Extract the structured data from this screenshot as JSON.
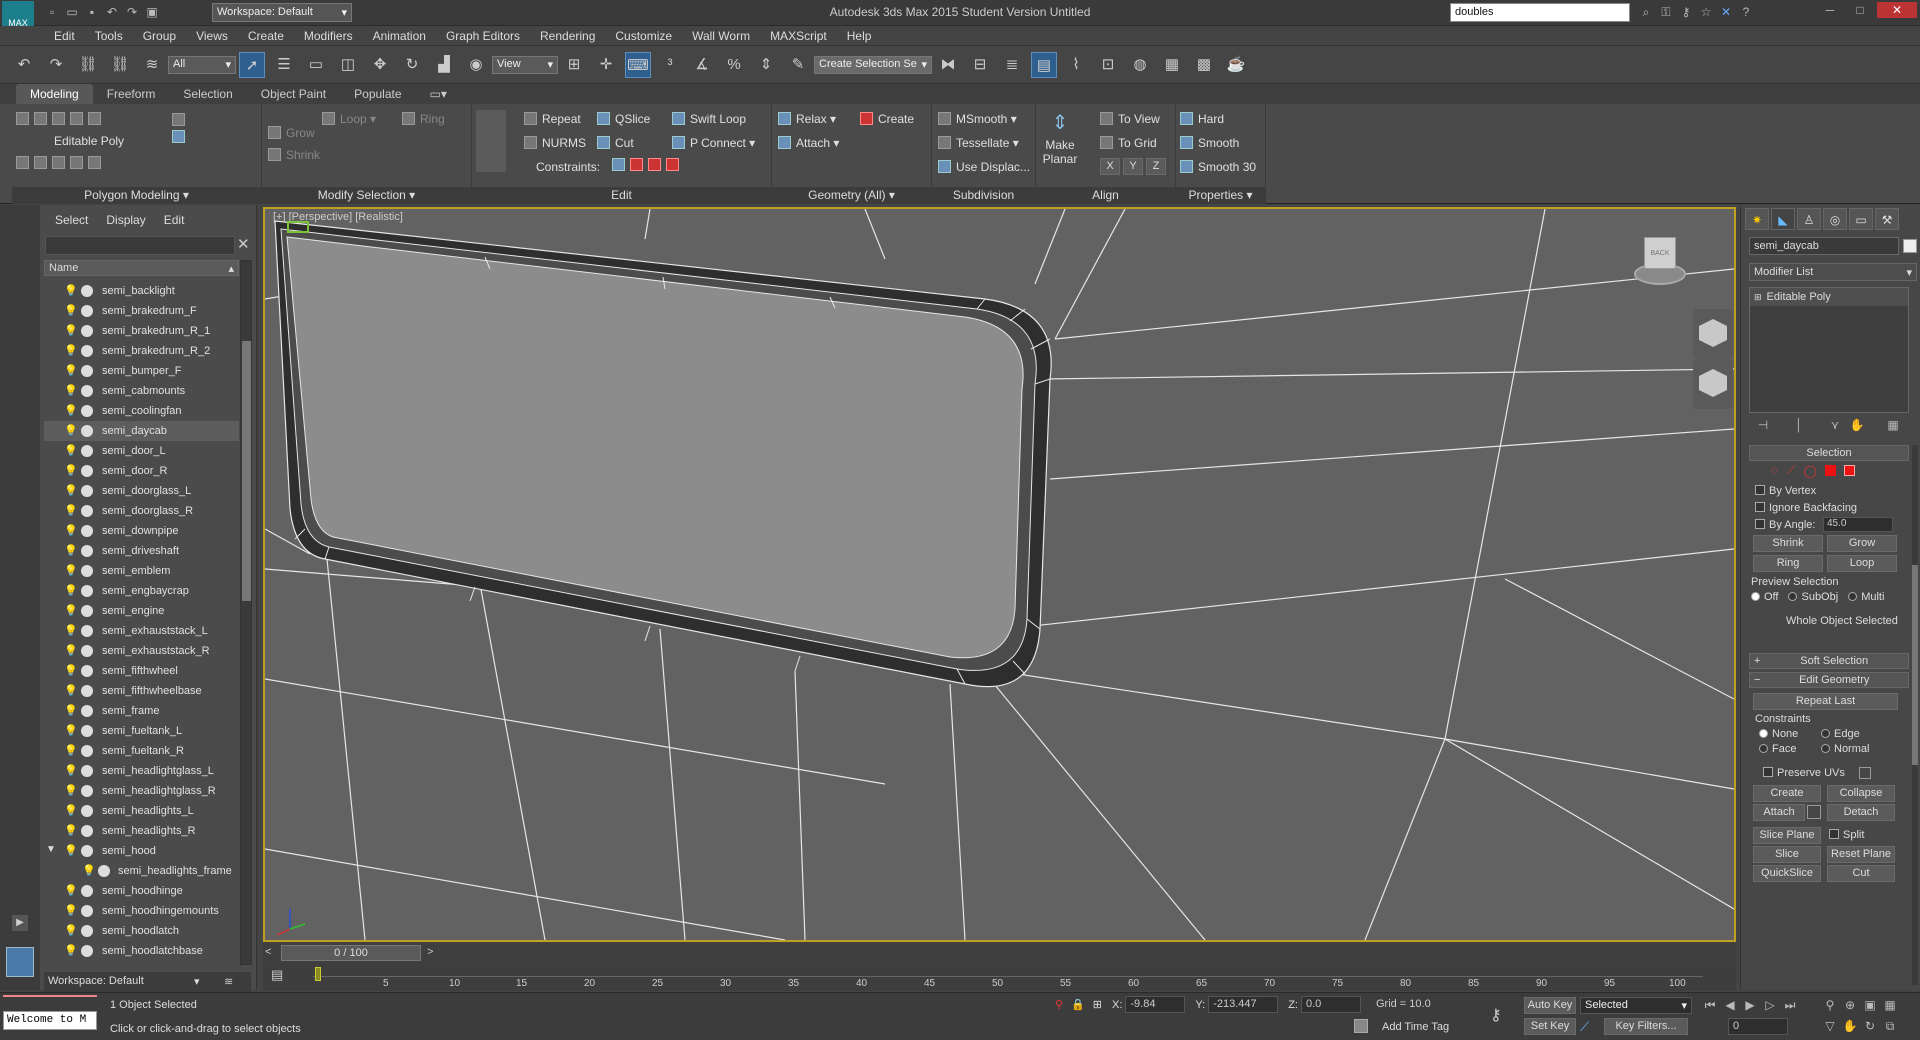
{
  "title": "Autodesk 3ds Max 2015    Student Version    Untitled",
  "workspace_dropdown": "Workspace: Default",
  "search": "doubles",
  "menus": [
    "Edit",
    "Tools",
    "Group",
    "Views",
    "Create",
    "Modifiers",
    "Animation",
    "Graph Editors",
    "Rendering",
    "Customize",
    "Wall Worm",
    "MAXScript",
    "Help"
  ],
  "toolbar": {
    "selection_filter": "All",
    "ref_coord": "View",
    "named_sel": "Create Selection Se"
  },
  "ribbon_tabs": [
    "Modeling",
    "Freeform",
    "Selection",
    "Object Paint",
    "Populate"
  ],
  "ribbon": {
    "polygon_modeling": {
      "label": "Editable Poly",
      "title": "Polygon Modeling"
    },
    "modify_selection": {
      "grow": "Grow",
      "shrink": "Shrink",
      "loop": "Loop",
      "ring": "Ring",
      "title": "Modify Selection"
    },
    "edit": {
      "repeat": "Repeat",
      "qslice": "QSlice",
      "swift_loop": "Swift Loop",
      "nurms": "NURMS",
      "cut": "Cut",
      "p_connect": "P Connect",
      "constraints": "Constraints:",
      "title": "Edit"
    },
    "geometry": {
      "relax": "Relax",
      "create": "Create",
      "attach": "Attach",
      "title": "Geometry (All)"
    },
    "subdivision": {
      "msmooth": "MSmooth",
      "tessellate": "Tessellate",
      "use_displac": "Use Displac...",
      "title": "Subdivision"
    },
    "align": {
      "make": "Make",
      "planar": "Planar",
      "to_view": "To View",
      "to_grid": "To Grid",
      "x": "X",
      "y": "Y",
      "z": "Z",
      "title": "Align"
    },
    "properties": {
      "hard": "Hard",
      "smooth": "Smooth",
      "smooth30": "Smooth 30",
      "title": "Properties"
    }
  },
  "explorer": {
    "menus": [
      "Select",
      "Display",
      "Edit"
    ],
    "column": "Name",
    "items": [
      {
        "name": "semi_backlight"
      },
      {
        "name": "semi_brakedrum_F"
      },
      {
        "name": "semi_brakedrum_R_1"
      },
      {
        "name": "semi_brakedrum_R_2"
      },
      {
        "name": "semi_bumper_F"
      },
      {
        "name": "semi_cabmounts"
      },
      {
        "name": "semi_coolingfan"
      },
      {
        "name": "semi_daycab"
      },
      {
        "name": "semi_door_L"
      },
      {
        "name": "semi_door_R"
      },
      {
        "name": "semi_doorglass_L"
      },
      {
        "name": "semi_doorglass_R"
      },
      {
        "name": "semi_downpipe"
      },
      {
        "name": "semi_driveshaft"
      },
      {
        "name": "semi_emblem"
      },
      {
        "name": "semi_engbaycrap"
      },
      {
        "name": "semi_engine"
      },
      {
        "name": "semi_exhauststack_L"
      },
      {
        "name": "semi_exhauststack_R"
      },
      {
        "name": "semi_fifthwheel"
      },
      {
        "name": "semi_fifthwheelbase"
      },
      {
        "name": "semi_frame"
      },
      {
        "name": "semi_fueltank_L"
      },
      {
        "name": "semi_fueltank_R"
      },
      {
        "name": "semi_headlightglass_L"
      },
      {
        "name": "semi_headlightglass_R"
      },
      {
        "name": "semi_headlights_L"
      },
      {
        "name": "semi_headlights_R"
      },
      {
        "name": "semi_hood"
      },
      {
        "name": "semi_headlights_frame"
      },
      {
        "name": "semi_hoodhinge"
      },
      {
        "name": "semi_hoodhingemounts"
      },
      {
        "name": "semi_hoodlatch"
      },
      {
        "name": "semi_hoodlatchbase"
      }
    ],
    "footer": "Workspace: Default"
  },
  "viewport_label": "[+] [Perspective] [Realistic]",
  "command_panel": {
    "object_name": "semi_daycab",
    "modifier_list": "Modifier List",
    "stack_item": "Editable Poly",
    "selection": {
      "title": "Selection",
      "by_vertex": "By Vertex",
      "ignore_backfacing": "Ignore Backfacing",
      "by_angle": "By Angle:",
      "angle_value": "45.0",
      "shrink": "Shrink",
      "grow": "Grow",
      "ring": "Ring",
      "loop": "Loop",
      "preview": "Preview Selection",
      "off": "Off",
      "subobj": "SubObj",
      "multi": "Multi",
      "status": "Whole Object Selected"
    },
    "soft_selection": "Soft Selection",
    "edit_geometry": {
      "title": "Edit Geometry",
      "repeat_last": "Repeat Last",
      "constraints": "Constraints",
      "none": "None",
      "edge": "Edge",
      "face": "Face",
      "normal": "Normal",
      "preserve_uvs": "Preserve UVs",
      "create": "Create",
      "collapse": "Collapse",
      "attach": "Attach",
      "detach": "Detach",
      "slice_plane": "Slice Plane",
      "split": "Split",
      "slice": "Slice",
      "reset_plane": "Reset Plane",
      "quickslice": "QuickSlice",
      "cut": "Cut"
    }
  },
  "timeline": {
    "frame": "0 / 100",
    "ticks": [
      "5",
      "10",
      "15",
      "20",
      "25",
      "30",
      "35",
      "40",
      "45",
      "50",
      "55",
      "60",
      "65",
      "70",
      "75",
      "80",
      "85",
      "90",
      "95",
      "100"
    ]
  },
  "status": {
    "maxscript": "Welcome to M",
    "selected": "1 Object Selected",
    "prompt": "Click or click-and-drag to select objects",
    "x_label": "X:",
    "x": "-9.84",
    "y_label": "Y:",
    "y": "-213.447",
    "z_label": "Z:",
    "z": "0.0",
    "grid": "Grid = 10.0",
    "add_time_tag": "Add Time Tag",
    "auto_key": "Auto Key",
    "set_key": "Set Key",
    "key_mode": "Selected",
    "key_filters": "Key Filters...",
    "frame_field": "0"
  }
}
